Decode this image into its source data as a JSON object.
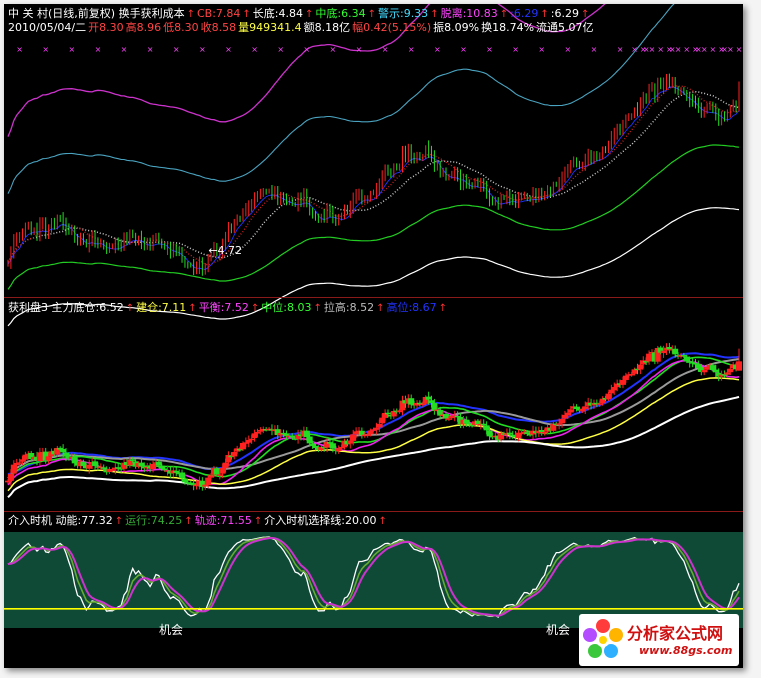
{
  "colors": {
    "background": "#000000",
    "rise": "#ff2020",
    "fall": "#22dd22",
    "osc_panel": "#0f4a36",
    "band_top": "#cc33cc",
    "band_cyan": "#4aa3c0",
    "band_green": "#22cc22",
    "band_white": "#ffffff",
    "ma_blue": "#2233ff",
    "ma_gray": "#9a9a9a",
    "ma_yellow": "#ffff44",
    "ma_magenta": "#ee22ee",
    "threshold": "#ffff00",
    "signal": "#ff44ff"
  },
  "header": {
    "row1": [
      {
        "text": "中 关 村(日线,前复权) 换手获利成本",
        "color": "#ffffff"
      },
      {
        "text": "CB:7.84",
        "color": "#ff4444"
      },
      {
        "text": "长底:4.84",
        "color": "#ffffff"
      },
      {
        "text": "中底:6.34",
        "color": "#33ff33"
      },
      {
        "text": "警示:9.33",
        "color": "#44ddff"
      },
      {
        "text": "脱离:10.83",
        "color": "#ff44ff"
      },
      {
        "text": ":6.29",
        "color": "#2233ff"
      },
      {
        "text": ":6.29",
        "color": "#ffffff"
      }
    ],
    "row2": [
      {
        "text": "2010/05/04/二",
        "color": "#ffffff"
      },
      {
        "text": "开8.30",
        "color": "#ff4444"
      },
      {
        "text": "高8.96",
        "color": "#ff4444"
      },
      {
        "text": "低8.30",
        "color": "#ff4444"
      },
      {
        "text": "收8.58",
        "color": "#ff4444"
      },
      {
        "text": "量949341.4",
        "color": "#ffff44"
      },
      {
        "text": "额8.18亿",
        "color": "#ffffff"
      },
      {
        "text": "幅0.42(5.15%)",
        "color": "#ff4444"
      },
      {
        "text": "振8.09%",
        "color": "#ffffff"
      },
      {
        "text": "换18.74%",
        "color": "#ffffff"
      },
      {
        "text": "流通5.07亿",
        "color": "#ffffff"
      }
    ],
    "row3": [
      {
        "text": "获利盘3  主力底仓:6.52",
        "color": "#ffffff"
      },
      {
        "text": "建仓:7.11",
        "color": "#ffff44"
      },
      {
        "text": "平衡:7.52",
        "color": "#ff44ff"
      },
      {
        "text": "中位:8.03",
        "color": "#33ff33"
      },
      {
        "text": "拉高:8.52",
        "color": "#bbbbbb"
      },
      {
        "text": "高位:8.67",
        "color": "#2233ff"
      }
    ],
    "row4": [
      {
        "text": "介入时机   动能:77.32",
        "color": "#ffffff"
      },
      {
        "text": "运行:74.25",
        "color": "#33aa33"
      },
      {
        "text": "轨迹:71.55",
        "color": "#ff44ff"
      },
      {
        "text": "介入时机选择线:20.00",
        "color": "#ffffff"
      }
    ]
  },
  "annotations": {
    "low_marker": "←4.72",
    "chance_1": "机会",
    "chance_2": "机会"
  },
  "watermark": {
    "title": "分析家公式网",
    "url": "www.88gs.com"
  },
  "chart_data": [
    {
      "type": "candlestick",
      "title": "中关村(日线,前复权) 换手获利成本",
      "date": "2010/05/04",
      "ylim": [
        4.3,
        10.0
      ],
      "low_annotation": 4.72,
      "last": {
        "open": 8.3,
        "high": 8.96,
        "low": 8.3,
        "close": 8.58,
        "volume": 949341.4
      },
      "close": [
        5.0,
        5.2,
        5.48,
        5.53,
        5.55,
        5.64,
        5.78,
        5.81,
        5.65,
        5.71,
        5.61,
        5.85,
        5.86,
        5.62,
        5.73,
        5.88,
        5.79,
        5.98,
        5.93,
        5.85,
        5.72,
        5.72,
        5.71,
        5.52,
        5.45,
        5.57,
        5.44,
        5.37,
        5.48,
        5.56,
        5.44,
        5.41,
        5.42,
        5.36,
        5.25,
        5.35,
        5.34,
        5.39,
        5.39,
        5.35,
        5.54,
        5.47,
        5.63,
        5.6,
        5.42,
        5.53,
        5.43,
        5.39,
        5.41,
        5.36,
        5.5,
        5.55,
        5.46,
        5.36,
        5.32,
        5.31,
        5.21,
        5.31,
        5.24,
        5.23,
        5.07,
        4.95,
        4.92,
        4.93,
        4.86,
        4.88,
        5.0,
        4.81,
        4.88,
        5.09,
        5.16,
        5.38,
        5.18,
        5.19,
        5.38,
        5.54,
        5.77,
        5.73,
        5.86,
        5.97,
        5.94,
        6.13,
        6.15,
        6.22,
        6.26,
        6.42,
        6.46,
        6.52,
        6.55,
        6.54,
        6.56,
        6.51,
        6.53,
        6.37,
        6.43,
        6.4,
        6.33,
        6.35,
        6.29,
        6.26,
        6.38,
        6.34,
        6.5,
        6.31,
        6.12,
        6.04,
        5.98,
        5.92,
        6.01,
        6.01,
        6.16,
        6.11,
        5.96,
        5.89,
        5.97,
        6.01,
        6.2,
        6.09,
        6.2,
        6.39,
        6.48,
        6.5,
        6.36,
        6.38,
        6.39,
        6.5,
        6.54,
        6.59,
        6.7,
        6.89,
        7.03,
        6.99,
        6.93,
        7.09,
        7.07,
        7.11,
        7.4,
        7.32,
        7.47,
        7.28,
        7.26,
        7.33,
        7.3,
        7.31,
        7.51,
        7.43,
        7.33,
        7.1,
        7.13,
        6.95,
        6.98,
        6.86,
        6.87,
        6.95,
        6.95,
        6.9,
        6.7,
        6.83,
        6.71,
        6.69,
        6.67,
        6.78,
        6.69,
        6.7,
        6.68,
        6.51,
        6.33,
        6.34,
        6.35,
        6.22,
        6.43,
        6.41,
        6.42,
        6.38,
        6.37,
        6.3,
        6.44,
        6.44,
        6.47,
        6.4,
        6.37,
        6.5,
        6.43,
        6.5,
        6.46,
        6.46,
        6.6,
        6.5,
        6.7,
        6.7,
        6.72,
        6.85,
        6.97,
        7.04,
        7.14,
        7.23,
        7.15,
        7.1,
        7.15,
        7.23,
        7.35,
        7.26,
        7.32,
        7.31,
        7.32,
        7.46,
        7.45,
        7.61,
        7.73,
        7.81,
        7.91,
        7.89,
        8.02,
        8.15,
        8.19,
        8.2,
        8.34,
        8.34,
        8.48,
        8.61,
        8.58,
        8.81,
        8.86,
        8.57,
        8.98,
        8.84,
        8.9,
        8.99,
        8.94,
        8.95,
        8.79,
        8.74,
        8.76,
        8.74,
        8.58,
        8.54,
        8.54,
        8.49,
        8.38,
        8.26,
        8.32,
        8.41,
        8.47,
        8.32,
        8.25,
        8.12,
        8.18,
        8.19,
        8.25,
        8.36,
        8.49,
        8.34,
        8.58
      ]
    },
    {
      "type": "candlestick",
      "title": "获利盘3",
      "ylim": [
        4.3,
        10.0
      ],
      "series": [
        {
          "name": "主力底仓",
          "last": 6.52
        },
        {
          "name": "建仓",
          "last": 7.11
        },
        {
          "name": "平衡",
          "last": 7.52
        },
        {
          "name": "中位",
          "last": 8.03
        },
        {
          "name": "拉高",
          "last": 8.52
        },
        {
          "name": "高位",
          "last": 8.67
        }
      ]
    },
    {
      "type": "line",
      "title": "介入时机",
      "ylim": [
        0,
        100
      ],
      "threshold": 20.0,
      "series": [
        {
          "name": "动能",
          "last": 77.32
        },
        {
          "name": "运行",
          "last": 74.25
        },
        {
          "name": "轨迹",
          "last": 71.55
        },
        {
          "name": "介入时机选择线",
          "last": 20.0
        }
      ]
    }
  ]
}
